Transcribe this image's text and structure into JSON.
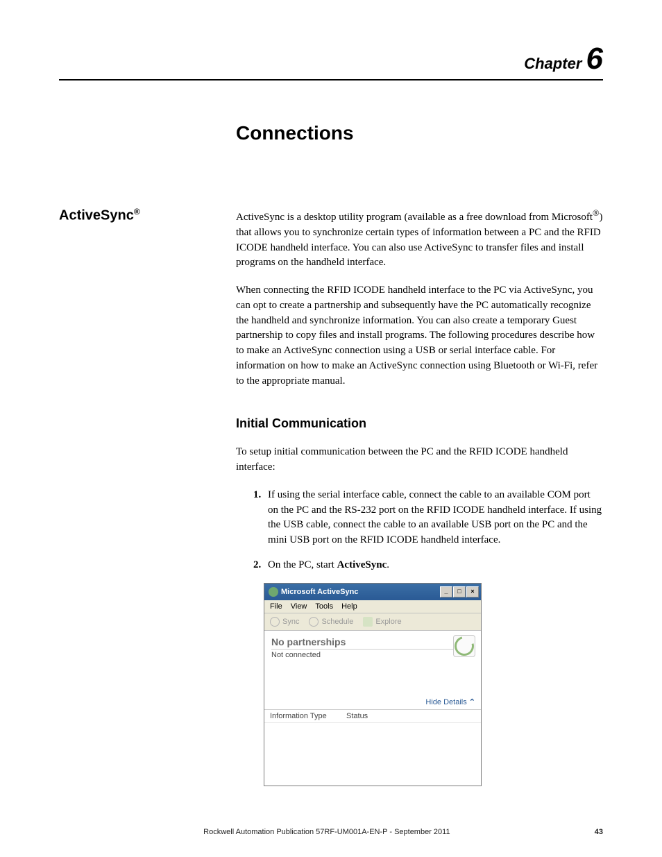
{
  "chapter": {
    "label": "Chapter",
    "number": "6"
  },
  "title": "Connections",
  "side_heading": {
    "text": "ActiveSync",
    "sup": "®"
  },
  "para1a": "ActiveSync is a desktop utility program (available as a free download from Microsoft",
  "para1sup": "®",
  "para1b": ") that allows you to synchronize certain types of information between a PC and the RFID ICODE handheld interface. You can also use ActiveSync to transfer files and install programs on the handheld interface.",
  "para2": "When connecting the RFID ICODE handheld interface to the PC via ActiveSync, you can opt to create a partnership and subsequently have the PC automatically recognize the handheld and synchronize information. You can also create a temporary Guest partnership to copy files and install programs. The following procedures describe how to make an ActiveSync connection using a USB or serial interface cable. For information on how to make an ActiveSync connection using Bluetooth or Wi-Fi, refer to the appropriate manual.",
  "subheading": "Initial Communication",
  "para3": "To setup initial communication between the PC and the RFID ICODE handheld interface:",
  "steps": [
    "If using the serial interface cable, connect the cable to an available COM port on the PC and the RS-232 port on the RFID ICODE handheld interface. If using the USB cable, connect the cable to an available USB port on the PC and the mini USB port on the RFID ICODE handheld interface.",
    {
      "pre": "On the PC, start ",
      "bold": "ActiveSync",
      "post": "."
    }
  ],
  "window": {
    "title": "Microsoft ActiveSync",
    "menus": [
      "File",
      "View",
      "Tools",
      "Help"
    ],
    "toolbar": [
      "Sync",
      "Schedule",
      "Explore"
    ],
    "status_title": "No partnerships",
    "status_sub": "Not connected",
    "hide_details": "Hide Details",
    "columns": [
      "Information Type",
      "Status"
    ],
    "win_btn_min": "_",
    "win_btn_max": "□",
    "win_btn_close": "×"
  },
  "footer": {
    "pub": "Rockwell Automation Publication 57RF-UM001A-EN-P - September 2011",
    "page": "43"
  }
}
